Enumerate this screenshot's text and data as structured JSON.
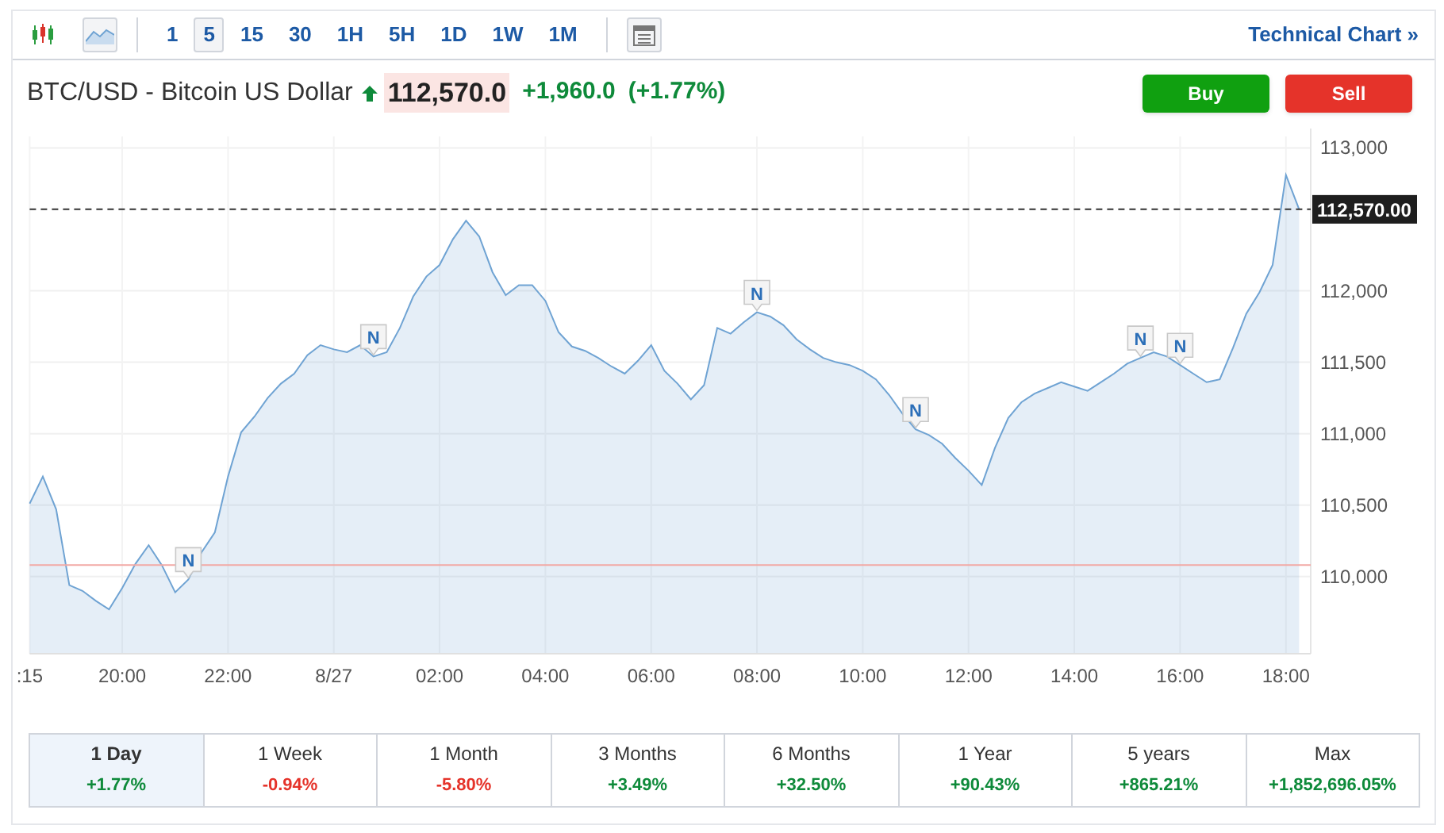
{
  "toolbar": {
    "area_chart_button": {
      "selected": true
    },
    "intervals": [
      {
        "label": "1",
        "selected": false
      },
      {
        "label": "5",
        "selected": true
      },
      {
        "label": "15",
        "selected": false
      },
      {
        "label": "30",
        "selected": false
      },
      {
        "label": "1H",
        "selected": false
      },
      {
        "label": "5H",
        "selected": false
      },
      {
        "label": "1D",
        "selected": false
      },
      {
        "label": "1W",
        "selected": false
      },
      {
        "label": "1M",
        "selected": false
      }
    ],
    "link": "Technical Chart »"
  },
  "quote": {
    "title": "BTC/USD - Bitcoin US Dollar",
    "color": "#0e8a3a",
    "price": "112,570.0",
    "change": "+1,960.0",
    "change_percent": "(+1.77%)"
  },
  "buttons": [
    {
      "label": "Buy",
      "kind": "buy"
    },
    {
      "label": "Sell",
      "kind": "sell"
    }
  ],
  "chart": {
    "chart_data": {
      "type": "area",
      "categories": [
        ":15",
        null,
        null,
        null,
        null,
        null,
        null,
        "20:00",
        null,
        null,
        null,
        null,
        null,
        null,
        null,
        "22:00",
        null,
        null,
        null,
        null,
        null,
        null,
        null,
        "8/27",
        null,
        null,
        null,
        null,
        null,
        null,
        null,
        "02:00",
        null,
        null,
        null,
        null,
        null,
        null,
        null,
        "04:00",
        null,
        null,
        null,
        null,
        null,
        null,
        null,
        "06:00",
        null,
        null,
        null,
        null,
        null,
        null,
        null,
        "08:00",
        null,
        null,
        null,
        null,
        null,
        null,
        null,
        "10:00",
        null,
        null,
        null,
        null,
        null,
        null,
        null,
        "12:00",
        null,
        null,
        null,
        null,
        null,
        null,
        null,
        "14:00",
        null,
        null,
        null,
        null,
        null,
        null,
        null,
        "16:00",
        null,
        null,
        null,
        null,
        null,
        null,
        null,
        "18:00",
        null
      ],
      "grid": true,
      "series": [
        {
          "color": "#6fa3d3",
          "values": [
            110510,
            110700,
            110470,
            109940,
            109900,
            109830,
            109770,
            109920,
            110090,
            110220,
            110080,
            109890,
            109980,
            110170,
            110310,
            110700,
            111010,
            111120,
            111250,
            111350,
            111420,
            111550,
            111620,
            111590,
            111570,
            111620,
            111540,
            111570,
            111740,
            111960,
            112100,
            112180,
            112360,
            112490,
            112380,
            112130,
            111970,
            112040,
            112040,
            111930,
            111710,
            111610,
            111580,
            111530,
            111470,
            111420,
            111510,
            111620,
            111440,
            111350,
            111240,
            111340,
            111740,
            111700,
            111780,
            111850,
            111820,
            111760,
            111660,
            111590,
            111530,
            111500,
            111480,
            111440,
            111380,
            111270,
            111140,
            111030,
            110990,
            110930,
            110830,
            110740,
            110640,
            110900,
            111110,
            111220,
            111280,
            111320,
            111360,
            111330,
            111300,
            111360,
            111420,
            111490,
            111530,
            111570,
            111540,
            111480,
            111420,
            111360,
            111380,
            111600,
            111840,
            111990,
            112180,
            112810,
            112570
          ]
        }
      ],
      "ylim": [
        109460,
        113080
      ],
      "yticks": [
        {
          "value": 110000,
          "label": "110,000"
        },
        {
          "value": 110500,
          "label": "110,500"
        },
        {
          "value": 111000,
          "label": "111,000"
        },
        {
          "value": 111500,
          "label": "111,500"
        },
        {
          "value": 112000,
          "label": "112,000"
        },
        {
          "value": 113000,
          "label": "113,000"
        }
      ],
      "ref_lines": [
        {
          "axis": "y",
          "value": 112570,
          "label": "112,570.00",
          "color": "#333333"
        },
        {
          "axis": "y",
          "value": 110080,
          "color": "#f2a9a5"
        }
      ]
    },
    "news_markers": [
      {
        "label": "N"
      },
      {
        "label": "N"
      },
      {
        "label": "N"
      },
      {
        "label": "N"
      },
      {
        "label": "N"
      },
      {
        "label": "N"
      }
    ]
  },
  "periods": [
    {
      "label": "1 Day",
      "change": "+1.77%",
      "color": "#0e8a3a",
      "selected": true
    },
    {
      "label": "1 Week",
      "change": "-0.94%",
      "color": "#e5332a",
      "selected": false
    },
    {
      "label": "1 Month",
      "change": "-5.80%",
      "color": "#e5332a",
      "selected": false
    },
    {
      "label": "3 Months",
      "change": "+3.49%",
      "color": "#0e8a3a",
      "selected": false
    },
    {
      "label": "6 Months",
      "change": "+32.50%",
      "color": "#0e8a3a",
      "selected": false
    },
    {
      "label": "1 Year",
      "change": "+90.43%",
      "color": "#0e8a3a",
      "selected": false
    },
    {
      "label": "5 years",
      "change": "+865.21%",
      "color": "#0e8a3a",
      "selected": false
    },
    {
      "label": "Max",
      "change": "+1,852,696.05%",
      "color": "#0e8a3a",
      "selected": false
    }
  ]
}
